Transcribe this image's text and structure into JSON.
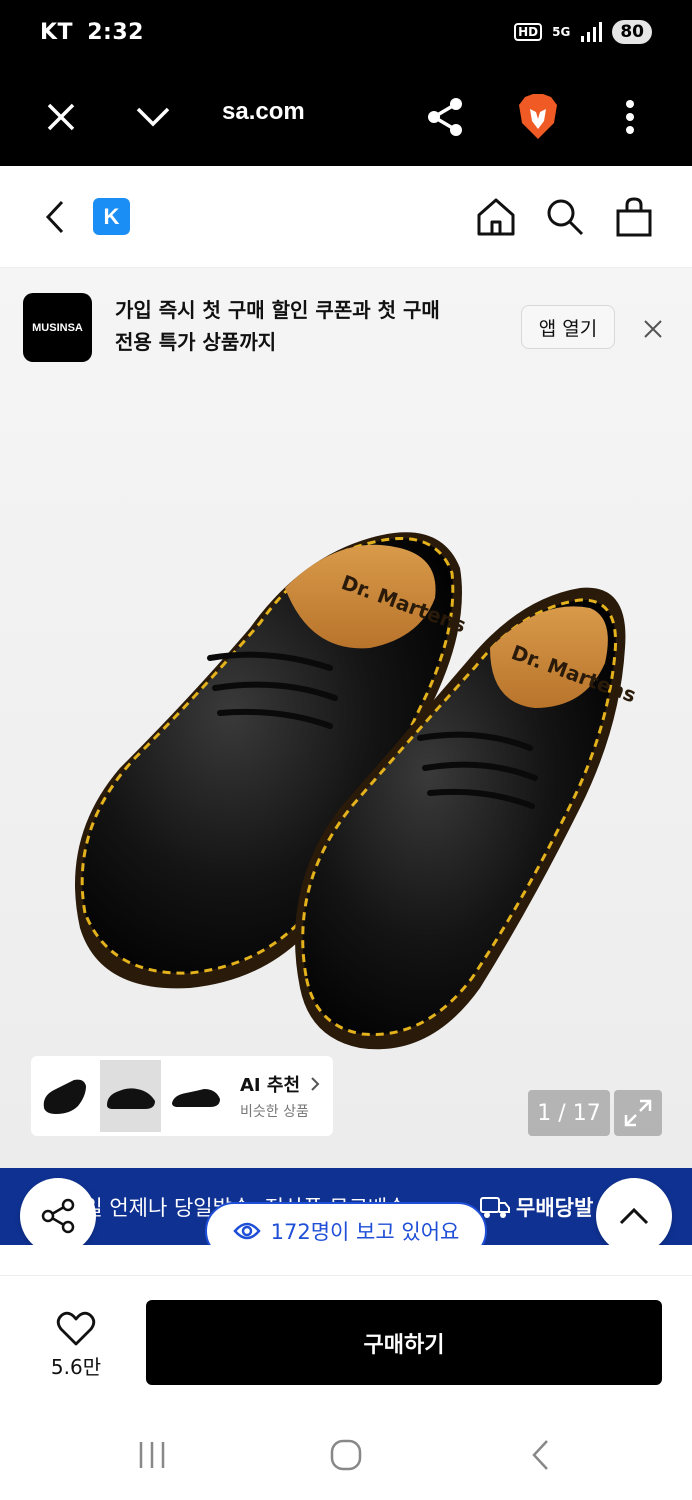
{
  "status_bar": {
    "carrier": "KT",
    "time": "2:32",
    "hd": "HD",
    "network": "5G",
    "battery": "80"
  },
  "browser": {
    "url": "sa.com"
  },
  "banner": {
    "logo_text": "MUSINSA",
    "text_line1": "가입 즉시 첫 구매 할인 쿠폰과 첫 구매",
    "text_line2": "전용 특가 상품까지",
    "open_label": "앱 열기"
  },
  "site": {
    "logo_letter": "K"
  },
  "product": {
    "insole_brand": "Dr. Martens",
    "image_counter": "1 / 17"
  },
  "ai_recommend": {
    "title": "AI 추천",
    "subtitle": "비슷한 상품"
  },
  "promo": {
    "text": "7일 언제나 당일발송, 전상품 무료배송",
    "badge_label": "무배당발"
  },
  "viewers": {
    "text": "172명이 보고 있어요"
  },
  "purchase": {
    "like_count": "5.6만",
    "buy_label": "구매하기"
  },
  "colors": {
    "accent_blue": "#1f4fd6",
    "promo_bg": "#0f3192",
    "logo_k_bg": "#1a8ef5"
  }
}
